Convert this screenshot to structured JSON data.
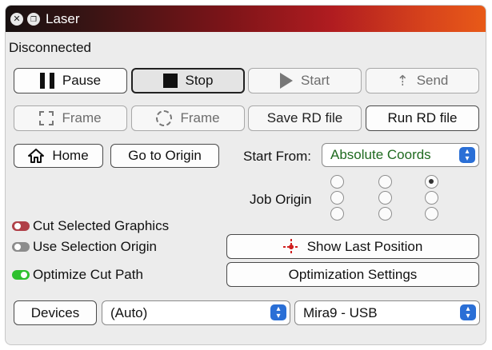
{
  "window": {
    "title": "Laser"
  },
  "status": "Disconnected",
  "row1": {
    "pause": "Pause",
    "stop": "Stop",
    "start": "Start",
    "send": "Send"
  },
  "row2": {
    "frame_rect": "Frame",
    "frame_circle": "Frame",
    "save_rd": "Save RD file",
    "run_rd": "Run RD file"
  },
  "row3": {
    "home": "Home",
    "go_to_origin": "Go to Origin",
    "start_from_label": "Start From:",
    "start_from_value": "Absolute Coords"
  },
  "job_origin": {
    "label": "Job Origin",
    "selected": "top-right"
  },
  "options": {
    "cut_selected": {
      "label": "Cut Selected Graphics",
      "state": "off"
    },
    "use_selection_origin": {
      "label": "Use Selection Origin",
      "state": "off"
    },
    "optimize_cut_path": {
      "label": "Optimize Cut Path",
      "state": "on"
    }
  },
  "show_last_position": "Show Last Position",
  "optimization_settings": "Optimization Settings",
  "bottom": {
    "devices": "Devices",
    "port_value": "(Auto)",
    "device_value": "Mira9 - USB"
  },
  "icons": {
    "pause": "pause-icon",
    "stop": "stop-icon",
    "start": "play-icon",
    "send": "upload-arrow-icon",
    "frame_rect": "dashed-square-icon",
    "frame_circle": "dashed-circle-icon",
    "home": "house-icon",
    "show_last_position": "crosshair-icon"
  },
  "colors": {
    "start_from_text": "#1f6a1f",
    "select_chevron": "#2a6fd6",
    "toggle_on": "#2ec02e",
    "toggle_red": "#b04048"
  }
}
